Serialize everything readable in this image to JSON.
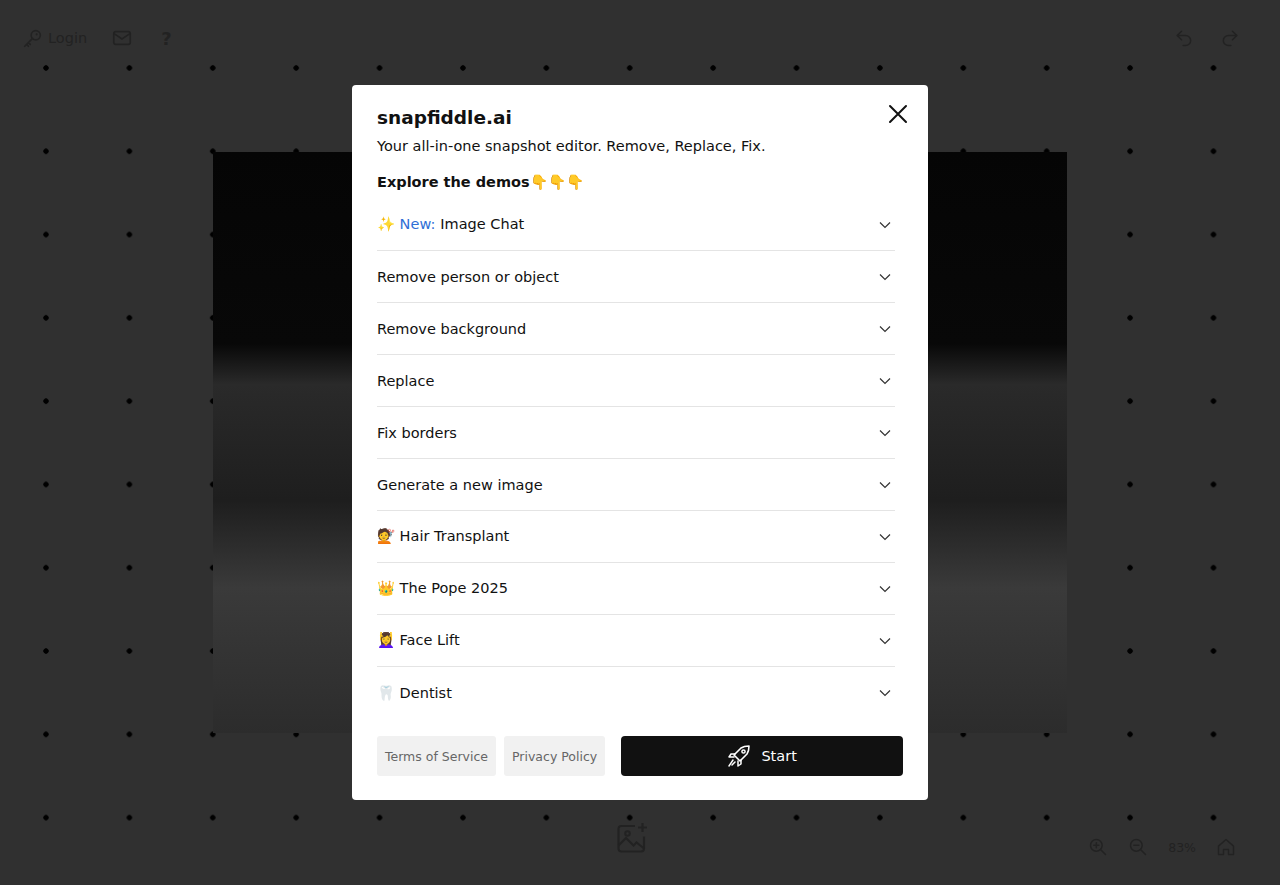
{
  "toolbar": {
    "login": "Login",
    "help": "?"
  },
  "modal": {
    "title": "snapfiddle.ai",
    "subtitle": "Your all-in-one snapshot editor. Remove, Replace, Fix.",
    "demos_heading": "Explore the demos👇👇👇",
    "items": [
      {
        "badge": "✨ New:",
        "label": "Image Chat",
        "expanded": false
      },
      {
        "badge": "",
        "label": "Remove person or object",
        "expanded": false
      },
      {
        "badge": "",
        "label": "Remove background",
        "expanded": false
      },
      {
        "badge": "",
        "label": "Replace",
        "expanded": false
      },
      {
        "badge": "",
        "label": "Fix borders",
        "expanded": false
      },
      {
        "badge": "",
        "label": "Generate a new image",
        "expanded": false
      },
      {
        "badge": "",
        "label": "💇 Hair Transplant",
        "expanded": false
      },
      {
        "badge": "",
        "label": "👑 The Pope 2025",
        "expanded": false
      },
      {
        "badge": "",
        "label": "💆‍♀️ Face Lift",
        "expanded": false
      },
      {
        "badge": "",
        "label": "🦷 Dentist",
        "expanded": false
      }
    ],
    "footer": {
      "links": [
        "Terms of Service",
        "Privacy Policy"
      ],
      "start": "Start"
    }
  },
  "zoom": {
    "level": "83%"
  }
}
